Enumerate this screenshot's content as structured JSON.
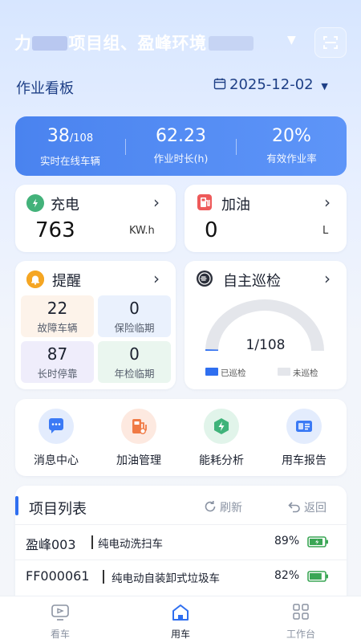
{
  "header": {
    "title_mid": "项目组、盈峰环境",
    "title_partial_start": "力",
    "caret": "▼"
  },
  "board": {
    "title": "作业看板",
    "date": "2025-12-02",
    "date_caret": "▼"
  },
  "stats": [
    {
      "value": "38",
      "sub": "/108",
      "label": "实时在线车辆"
    },
    {
      "value": "62.23",
      "sub": "",
      "label": "作业时长(h)"
    },
    {
      "value": "20%",
      "sub": "",
      "label": "有效作业率"
    }
  ],
  "charge": {
    "title": "充电",
    "value": "763",
    "unit": "KW.h",
    "chevron": "›"
  },
  "fuel": {
    "title": "加油",
    "value": "0",
    "unit": "L",
    "chevron": "›"
  },
  "reminder": {
    "title": "提醒",
    "chevron": "›",
    "cells": [
      {
        "value": "22",
        "label": "故障车辆"
      },
      {
        "value": "0",
        "label": "保险临期"
      },
      {
        "value": "87",
        "label": "长时停靠"
      },
      {
        "value": "0",
        "label": "年检临期"
      }
    ]
  },
  "patrol": {
    "title": "自主巡检",
    "chevron": "›",
    "value": "1/108",
    "done_fraction": 0.0093,
    "legend_done": "已巡检",
    "legend_todo": "未巡检",
    "colors": {
      "done": "#2f6ff0",
      "todo": "#e4e6eb"
    }
  },
  "quick_actions": [
    {
      "label": "消息中心",
      "icon": "message-icon",
      "color": "#3b7af5",
      "bg": "#e3ecfd"
    },
    {
      "label": "加油管理",
      "icon": "fuel-pump-icon",
      "color": "#f07a45",
      "bg": "#fde9e0"
    },
    {
      "label": "能耗分析",
      "icon": "energy-icon",
      "color": "#3fb37a",
      "bg": "#e1f4ea"
    },
    {
      "label": "用车报告",
      "icon": "report-card-icon",
      "color": "#3b7af5",
      "bg": "#e3ecfd"
    }
  ],
  "project_list": {
    "title": "项目列表",
    "refresh": "刷新",
    "back": "返回",
    "rows": [
      {
        "code": "盈峰003",
        "type": "纯电动洗扫车",
        "pct": "89%",
        "battery": 0.89
      },
      {
        "code": "FF000061",
        "type": "纯电动自装卸式垃圾车",
        "pct": "82%",
        "battery": 0.82
      }
    ]
  },
  "nav": [
    {
      "label": "看车",
      "icon": "vehicle-monitor-icon",
      "active": false
    },
    {
      "label": "用车",
      "icon": "home-icon",
      "active": true
    },
    {
      "label": "工作台",
      "icon": "grid-apps-icon",
      "active": false
    }
  ],
  "colors": {
    "accent": "#2f6ff0",
    "battery_green": "#3aa655"
  }
}
